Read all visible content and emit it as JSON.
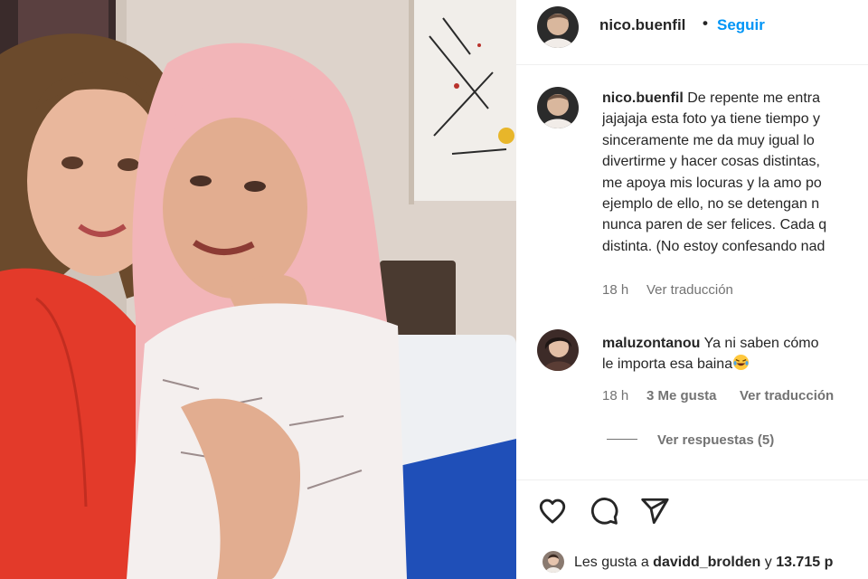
{
  "post": {
    "username": "nico.buenfil",
    "follow_label": "Seguir",
    "dot": "•"
  },
  "caption": {
    "username": "nico.buenfil",
    "lines": [
      "De repente me entra",
      "jajajaja esta foto ya tiene tiempo y",
      "sinceramente me da muy igual lo",
      "divertirme y hacer cosas distintas,",
      "me apoya mis locuras y la amo po",
      "ejemplo de ello, no se detengan n",
      "nunca paren de ser felices. Cada q",
      "distinta. (No estoy confesando nad"
    ],
    "time": "18 h",
    "translate": "Ver traducción"
  },
  "comment": {
    "username": "maluzontanou",
    "lines": [
      "Ya ni saben cómo",
      "le importa esa baina"
    ],
    "emoji": "laughing-crying-emoji",
    "time": "18 h",
    "likes": "3 Me gusta",
    "translate": "Ver traducción",
    "replies": "Ver respuestas (5)"
  },
  "actions": {
    "icons": [
      "heart-icon",
      "comment-icon",
      "share-icon"
    ]
  },
  "likes": {
    "prefix": "Les gusta a ",
    "user": "davidd_brolden",
    "joiner": " y ",
    "count": "13.715 p"
  },
  "colors": {
    "link": "#0095f6",
    "text": "#262626",
    "secondary": "#737373"
  }
}
